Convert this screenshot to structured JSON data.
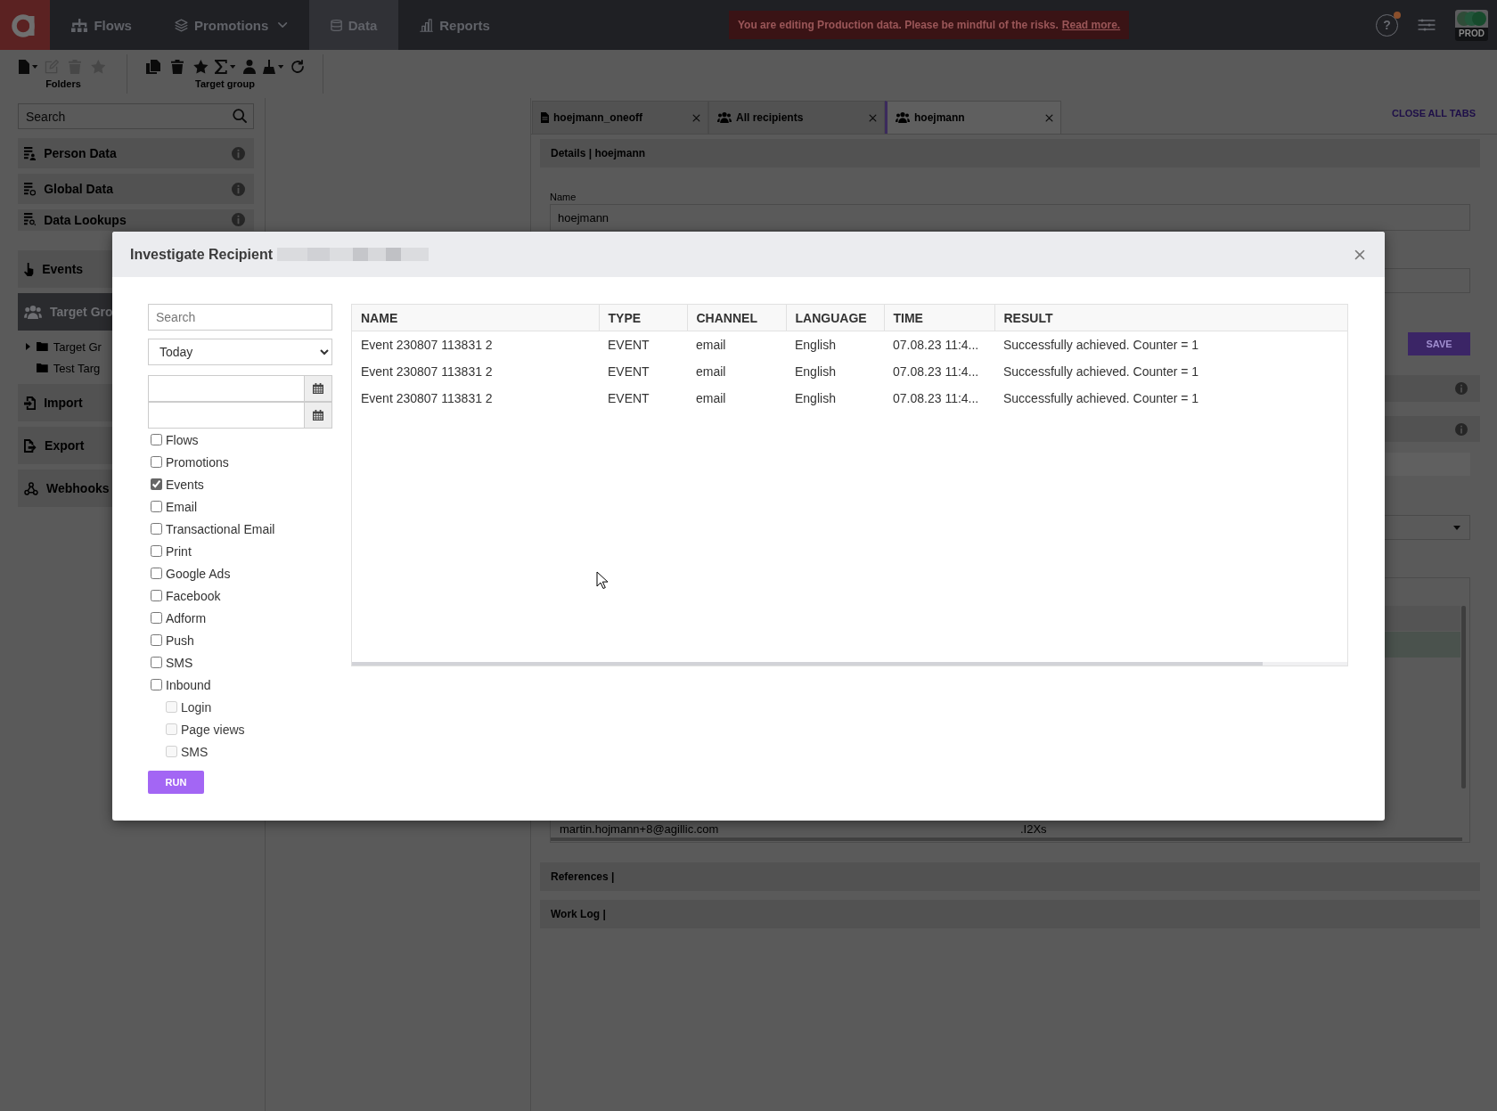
{
  "header": {
    "nav": [
      {
        "label": "Flows",
        "kind": "link",
        "selected": false
      },
      {
        "label": "Promotions",
        "kind": "dropdown",
        "selected": false
      },
      {
        "label": "Data",
        "kind": "link",
        "selected": true
      },
      {
        "label": "Reports",
        "kind": "link",
        "selected": false
      }
    ],
    "warning": {
      "text": "You are editing Production data. Please be mindful of the risks.",
      "link": "Read more."
    },
    "help": {
      "label": "?",
      "notification": true
    },
    "environment": {
      "label": "PROD",
      "on": true
    }
  },
  "toolbar": {
    "groups": [
      {
        "label": "Folders",
        "buttons": [
          {
            "dropdown": true,
            "disabled": false
          },
          {
            "dropdown": false,
            "disabled": true
          },
          {
            "dropdown": false,
            "disabled": true
          },
          {
            "dropdown": false,
            "disabled": true
          }
        ]
      },
      {
        "label": "Target group",
        "buttons": [
          {
            "dropdown": false,
            "disabled": false
          },
          {
            "dropdown": false,
            "disabled": false
          },
          {
            "dropdown": false,
            "disabled": false
          },
          {
            "dropdown": true,
            "disabled": false
          },
          {
            "dropdown": false,
            "disabled": false
          },
          {
            "dropdown": true,
            "disabled": false
          },
          {
            "dropdown": false,
            "disabled": false
          }
        ]
      }
    ]
  },
  "sidebar": {
    "search": {
      "placeholder": "Search"
    },
    "items": [
      {
        "label": "Person Data",
        "info": true,
        "selected": false
      },
      {
        "label": "Global Data",
        "info": true,
        "selected": false
      },
      {
        "label": "Data Lookups",
        "info": true,
        "selected": false
      },
      {
        "label": "Events",
        "selected": false
      },
      {
        "label": "Target Gro",
        "selected": true,
        "children": [
          {
            "label": "Target Gr",
            "expandable": true,
            "selected": false
          },
          {
            "label": "Test Targ",
            "expandable": false,
            "selected": false
          }
        ]
      },
      {
        "label": "Import",
        "selected": false
      },
      {
        "label": "Export",
        "selected": false
      },
      {
        "label": "Webhooks",
        "selected": false
      }
    ]
  },
  "tabs": {
    "items": [
      {
        "label": "hoejmann_oneoff",
        "kind": "document",
        "selected": false
      },
      {
        "label": "All recipients",
        "kind": "group",
        "selected": false
      },
      {
        "label": "hoejmann",
        "kind": "group",
        "selected": true
      }
    ],
    "close_all": "CLOSE ALL TABS"
  },
  "details": {
    "title": "Details | hoejmann",
    "name_label": "Name",
    "name_value": "hoejmann",
    "save_button": "SAVE",
    "sections": [
      {
        "info": true
      },
      {
        "info": true
      }
    ],
    "recipients": {
      "rows": [
        {
          "column_1": "martin.hojmann+8@agillic.com",
          "column_2": ".I2Xs"
        }
      ]
    },
    "panels": [
      {
        "title": "References |"
      },
      {
        "title": "Work Log |"
      }
    ]
  },
  "modal": {
    "title": "Investigate Recipient",
    "search": {
      "placeholder": "Search"
    },
    "period": {
      "value": "Today"
    },
    "filters": [
      {
        "label": "Flows",
        "checked": false,
        "disabled": false
      },
      {
        "label": "Promotions",
        "checked": false,
        "disabled": false
      },
      {
        "label": "Events",
        "checked": true,
        "disabled": false
      },
      {
        "label": "Email",
        "checked": false,
        "disabled": false
      },
      {
        "label": "Transactional Email",
        "checked": false,
        "disabled": false
      },
      {
        "label": "Print",
        "checked": false,
        "disabled": false
      },
      {
        "label": "Google Ads",
        "checked": false,
        "disabled": false
      },
      {
        "label": "Facebook",
        "checked": false,
        "disabled": false
      },
      {
        "label": "Adform",
        "checked": false,
        "disabled": false
      },
      {
        "label": "Push",
        "checked": false,
        "disabled": false
      },
      {
        "label": "SMS",
        "checked": false,
        "disabled": false
      },
      {
        "label": "Inbound",
        "checked": false,
        "disabled": false,
        "children": [
          {
            "label": "Login",
            "checked": false,
            "disabled": true
          },
          {
            "label": "Page views",
            "checked": false,
            "disabled": true
          },
          {
            "label": "SMS",
            "checked": false,
            "disabled": true
          }
        ]
      }
    ],
    "run_button": "RUN",
    "table": {
      "columns": [
        "NAME",
        "TYPE",
        "CHANNEL",
        "LANGUAGE",
        "TIME",
        "RESULT"
      ],
      "rows": [
        [
          "Event 230807 113831 2",
          "EVENT",
          "email",
          "English",
          "07.08.23 11:4...",
          "Successfully achieved. Counter = 1"
        ],
        [
          "Event 230807 113831 2",
          "EVENT",
          "email",
          "English",
          "07.08.23 11:4...",
          "Successfully achieved. Counter = 1"
        ],
        [
          "Event 230807 113831 2",
          "EVENT",
          "email",
          "English",
          "07.08.23 11:4...",
          "Successfully achieved. Counter = 1"
        ]
      ]
    }
  }
}
